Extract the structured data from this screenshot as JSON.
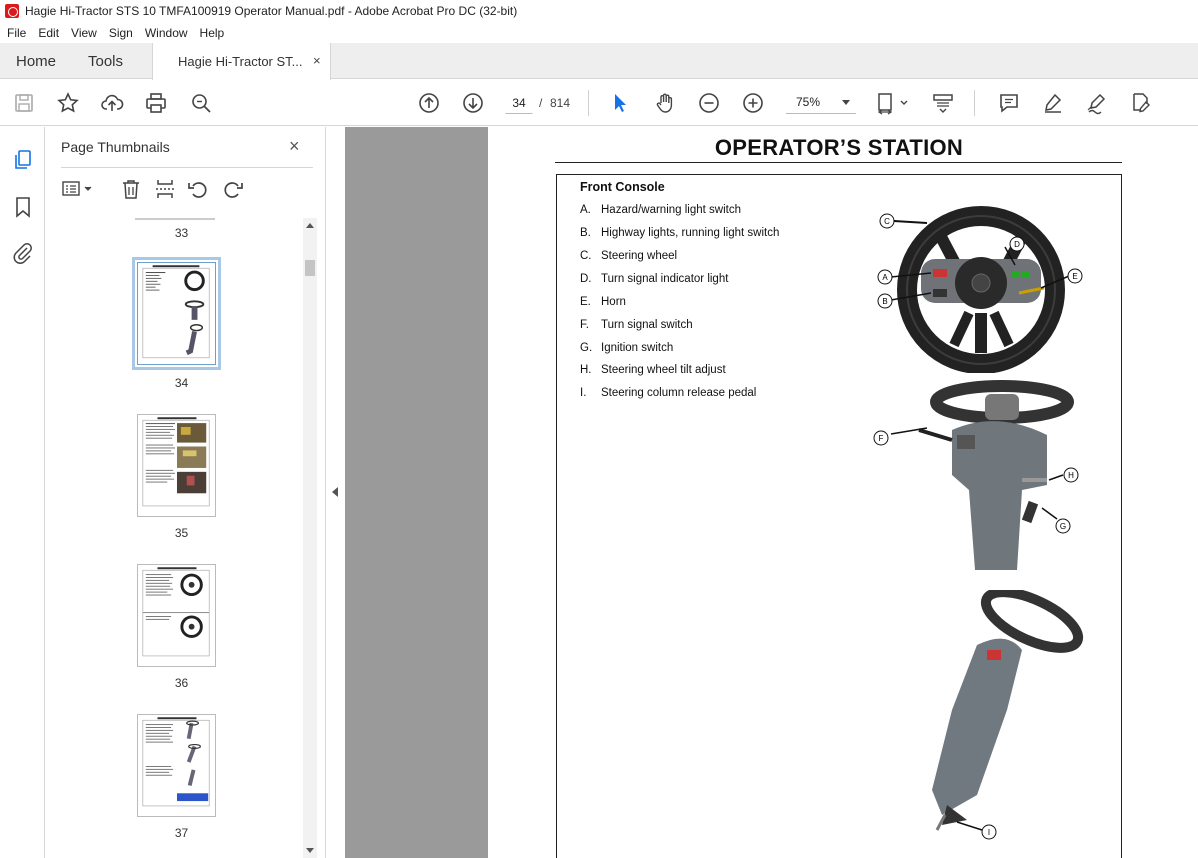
{
  "window": {
    "title": "Hagie Hi-Tractor STS 10 TMFA100919 Operator Manual.pdf - Adobe Acrobat Pro DC (32-bit)"
  },
  "menu": [
    "File",
    "Edit",
    "View",
    "Sign",
    "Window",
    "Help"
  ],
  "tabs": {
    "home": "Home",
    "tools": "Tools",
    "document": "Hagie Hi-Tractor ST...",
    "close": "×"
  },
  "toolbar": {
    "page_current": "34",
    "page_separator": "/",
    "page_total": "814",
    "zoom": "75%"
  },
  "sidebar": {
    "title": "Page Thumbnails",
    "close": "×",
    "thumbnails": [
      {
        "label": "33"
      },
      {
        "label": "34",
        "selected": true
      },
      {
        "label": "35"
      },
      {
        "label": "36"
      },
      {
        "label": "37"
      }
    ]
  },
  "document": {
    "heading": "OPERATOR’S STATION",
    "section_title": "Front Console",
    "parts": [
      {
        "letter": "A.",
        "text": "Hazard/warning light switch"
      },
      {
        "letter": "B.",
        "text": "Highway lights, running light switch"
      },
      {
        "letter": "C.",
        "text": "Steering wheel"
      },
      {
        "letter": "D.",
        "text": "Turn signal indicator light"
      },
      {
        "letter": "E.",
        "text": "Horn"
      },
      {
        "letter": "F.",
        "text": "Turn signal switch"
      },
      {
        "letter": "G.",
        "text": "Ignition switch"
      },
      {
        "letter": "H.",
        "text": "Steering wheel tilt adjust"
      },
      {
        "letter": "I.",
        "text": "Steering column release pedal"
      }
    ],
    "callouts_wheel": [
      "C",
      "D",
      "A",
      "E",
      "B"
    ],
    "callouts_column": [
      "F",
      "H",
      "G"
    ],
    "callouts_pedal": [
      "I"
    ]
  }
}
